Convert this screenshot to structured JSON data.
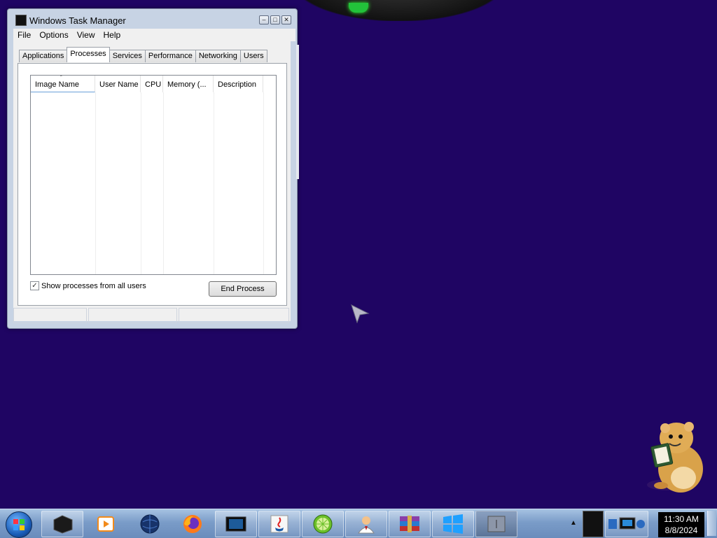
{
  "window": {
    "title": "Windows Task Manager",
    "controls": {
      "minimize": "–",
      "restore": "□",
      "close": "✕"
    }
  },
  "menu": [
    "File",
    "Options",
    "View",
    "Help"
  ],
  "tabs": [
    "Applications",
    "Processes",
    "Services",
    "Performance",
    "Networking",
    "Users"
  ],
  "active_tab": "Processes",
  "process_list": {
    "columns": [
      "Image Name",
      "User Name",
      "CPU",
      "Memory (...",
      "Description"
    ],
    "sorted_column": "Image Name",
    "rows": []
  },
  "show_all_users": {
    "label": "Show processes from all users",
    "checked": true
  },
  "end_process_label": "End Process",
  "taskbar": {
    "apps": [
      "terminal-icon",
      "media-player-icon",
      "network-globe-icon",
      "firefox-icon",
      "display-icon",
      "java-icon",
      "lime-icon",
      "user-doctor-icon",
      "winrar-icon",
      "windows-logo-icon",
      "task-manager-icon"
    ],
    "clock_time": "11:30 AM",
    "clock_date": "8/8/2024"
  }
}
